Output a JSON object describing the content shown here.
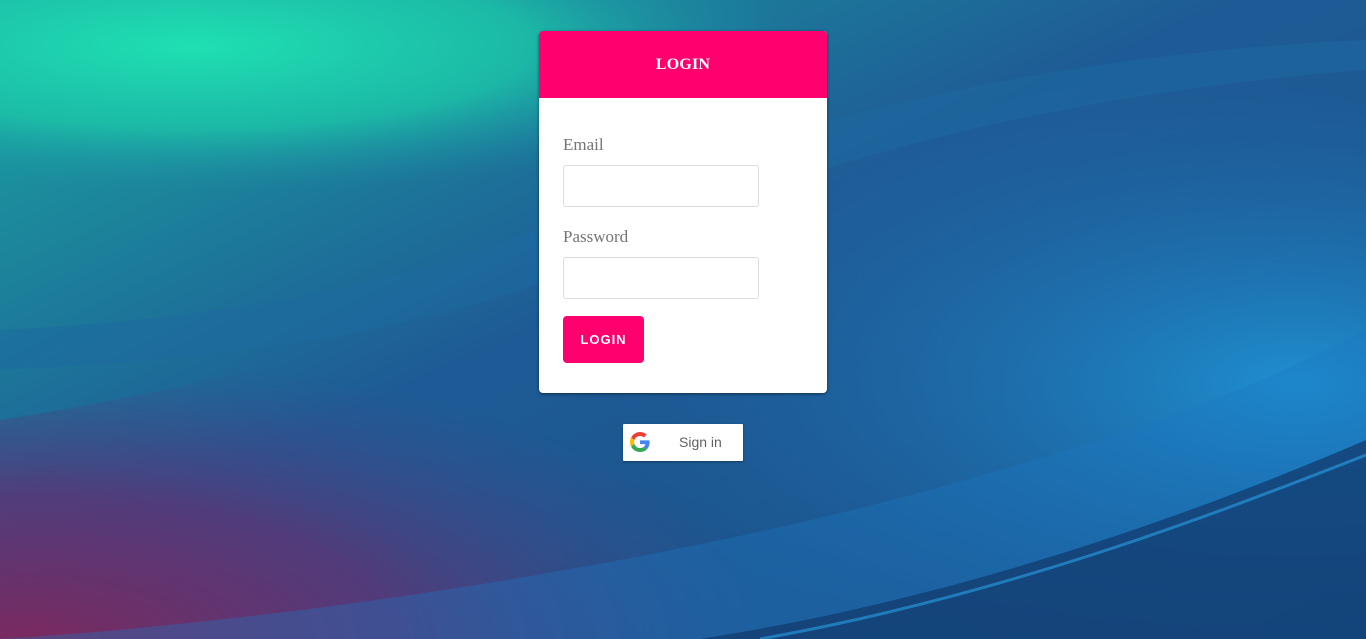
{
  "login_card": {
    "header_title": "LOGIN",
    "email_label": "Email",
    "email_value": "",
    "password_label": "Password",
    "password_value": "",
    "submit_label": "LOGIN"
  },
  "google_signin": {
    "label": "Sign in",
    "icon": "google-icon"
  },
  "colors": {
    "accent": "#ff006e",
    "card_background": "#ffffff",
    "label_text": "#757575"
  }
}
